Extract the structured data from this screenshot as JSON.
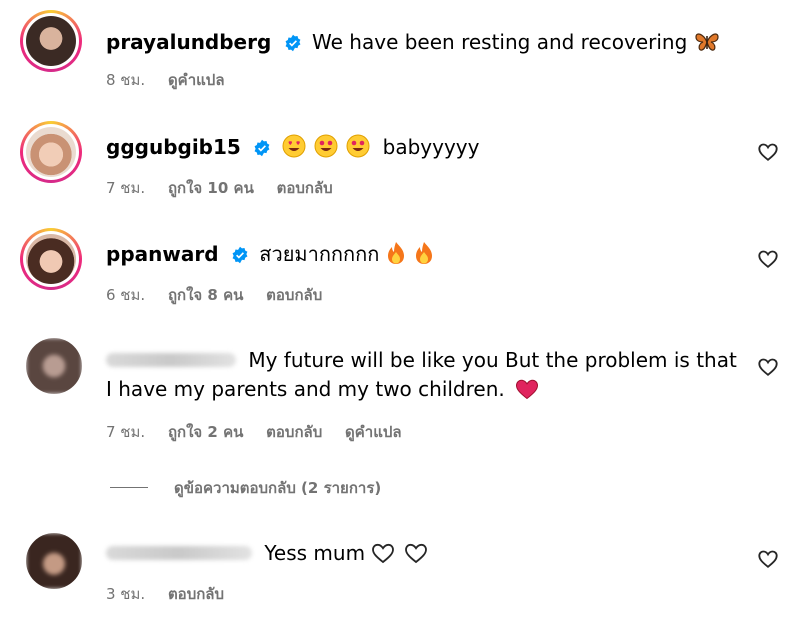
{
  "comments": [
    {
      "username": "prayalundberg",
      "verified": true,
      "text": "We have been resting and recovering",
      "emoji": "butterfly",
      "time": "8 ชม.",
      "actions": [
        "ดูคำแปล"
      ]
    },
    {
      "username": "gggubgib15",
      "verified": true,
      "text": "baby​yyyy",
      "emoji": "heart-eyes x3",
      "time": "7 ชม.",
      "likes": "ถูกใจ 10 คน",
      "actions": [
        "ตอบกลับ"
      ]
    },
    {
      "username": "ppanward",
      "verified": true,
      "text": "สวยมากกกกก",
      "emoji": "fire x2",
      "time": "6 ชม.",
      "likes": "ถูกใจ 8 คน",
      "actions": [
        "ตอบกลับ"
      ]
    },
    {
      "username_blurred": true,
      "text_line1": "My future will be like you But the problem is that",
      "text_line2": "I have my parents and my two children.",
      "emoji": "red-heart",
      "time": "7 ชม.",
      "likes": "ถูกใจ 2 คน",
      "actions": [
        "ตอบกลับ",
        "ดูคำแปล"
      ]
    },
    {
      "username_blurred": true,
      "text": "Yess mum",
      "emoji": "white-heart x2",
      "time": "3 ชม.",
      "actions": [
        "ตอบกลับ"
      ]
    }
  ],
  "replies_toggle": "ดูข้อความตอบกลับ (2 รายการ)",
  "colors": {
    "secondary_text": "#737373",
    "verified_blue": "#0095f6",
    "heart_red": "#e0245e"
  },
  "icons": [
    "verified-badge-icon",
    "heart-outline-icon",
    "butterfly-emoji",
    "heart-eyes-emoji",
    "fire-emoji",
    "red-heart-emoji"
  ]
}
